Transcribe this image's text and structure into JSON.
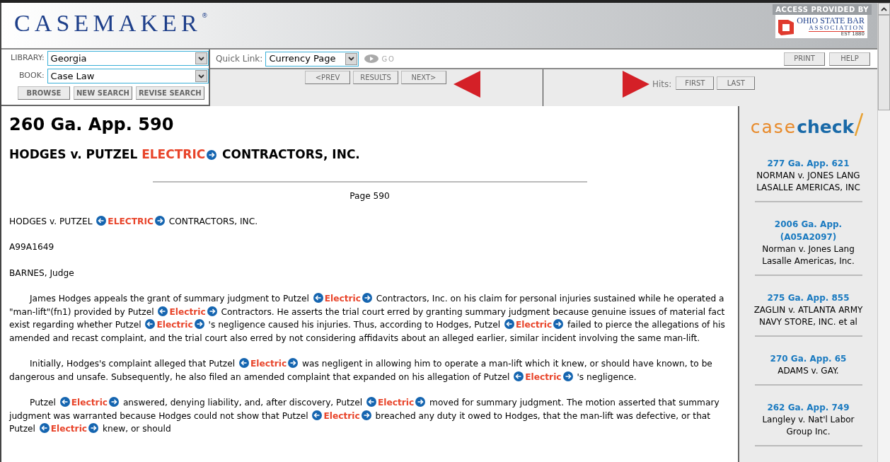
{
  "header": {
    "logo": "CASEMAKER",
    "logo_mark": "®",
    "access_label": "ACCESS PROVIDED BY",
    "partner": {
      "name": "OHIO STATE BAR",
      "subtitle": "ASSOCIATION",
      "est": "EST 1880"
    }
  },
  "search_panel": {
    "library": {
      "label": "LIBRARY:",
      "value": "Georgia"
    },
    "book": {
      "label": "BOOK:",
      "value": "Case Law"
    },
    "buttons": [
      "BROWSE",
      "NEW SEARCH",
      "REVISE SEARCH"
    ]
  },
  "quick_link": {
    "label": "Quick Link:",
    "value": "Currency Page",
    "go": "GO"
  },
  "top_buttons": [
    "PRINT",
    "HELP"
  ],
  "nav_buttons": [
    "<PREV",
    "RESULTS",
    "NEXT>"
  ],
  "hits": {
    "label": "Hits:",
    "buttons": [
      "FIRST",
      "LAST"
    ]
  },
  "document": {
    "citation": "260 Ga. App. 590",
    "title": [
      {
        "kind": "text",
        "text": "HODGES v. PUTZEL "
      },
      {
        "kind": "hit",
        "text": "ELECTRIC",
        "prev": false,
        "next": true
      },
      {
        "kind": "text",
        "text": " CONTRACTORS, INC."
      }
    ],
    "page_label": "Page 590",
    "blocks": [
      [
        {
          "kind": "text",
          "text": "HODGES v. PUTZEL "
        },
        {
          "kind": "hit",
          "text": "ELECTRIC",
          "prev": true,
          "next": true
        },
        {
          "kind": "text",
          "text": " CONTRACTORS, INC."
        }
      ],
      [
        {
          "kind": "text",
          "text": "A99A1649"
        }
      ],
      [
        {
          "kind": "text",
          "text": "BARNES, Judge"
        }
      ],
      [
        {
          "kind": "text",
          "text": "James Hodges appeals the grant of summary judgment to Putzel "
        },
        {
          "kind": "hit",
          "text": "Electric",
          "prev": true,
          "next": true
        },
        {
          "kind": "text",
          "text": " Contractors, Inc. on his claim for personal injuries sustained while he operated a \"man-lift\"(fn1) provided by Putzel "
        },
        {
          "kind": "hit",
          "text": "Electric",
          "prev": true,
          "next": true
        },
        {
          "kind": "text",
          "text": " Contractors. He asserts the trial court erred by granting summary judgment because genuine issues of material fact exist regarding whether Putzel "
        },
        {
          "kind": "hit",
          "text": "Electric",
          "prev": true,
          "next": true
        },
        {
          "kind": "text",
          "text": " 's negligence caused his injuries. Thus, according to Hodges, Putzel "
        },
        {
          "kind": "hit",
          "text": "Electric",
          "prev": true,
          "next": true
        },
        {
          "kind": "text",
          "text": " failed to pierce the allegations of his amended and recast complaint, and the trial court also erred by not considering affidavits about an alleged earlier, similar incident involving the same man-lift."
        }
      ],
      [
        {
          "kind": "text",
          "text": "Initially, Hodges's complaint alleged that Putzel "
        },
        {
          "kind": "hit",
          "text": "Electric",
          "prev": true,
          "next": true
        },
        {
          "kind": "text",
          "text": " was negligent in allowing him to operate a man-lift which it knew, or should have known, to be dangerous and unsafe. Subsequently, he also filed an amended complaint that expanded on his allegation of Putzel "
        },
        {
          "kind": "hit",
          "text": "Electric",
          "prev": true,
          "next": true
        },
        {
          "kind": "text",
          "text": " 's negligence."
        }
      ],
      [
        {
          "kind": "text",
          "text": "Putzel "
        },
        {
          "kind": "hit",
          "text": "Electric",
          "prev": true,
          "next": true
        },
        {
          "kind": "text",
          "text": " answered, denying liability, and, after discovery, Putzel "
        },
        {
          "kind": "hit",
          "text": "Electric",
          "prev": true,
          "next": true
        },
        {
          "kind": "text",
          "text": " moved for summary judgment. The motion asserted that summary judgment was warranted because Hodges could not show that Putzel "
        },
        {
          "kind": "hit",
          "text": "Electric",
          "prev": true,
          "next": true
        },
        {
          "kind": "text",
          "text": " breached any duty it owed to Hodges, that the man-lift was defective, or that Putzel "
        },
        {
          "kind": "hit",
          "text": "Electric",
          "prev": true,
          "next": true
        },
        {
          "kind": "text",
          "text": " knew, or should"
        }
      ]
    ]
  },
  "casecheck": {
    "logo_case": "case",
    "logo_check": "check",
    "cases": [
      {
        "citation": "277 Ga. App. 621",
        "name": "NORMAN v. JONES LANG LASALLE AMERICAS, INC"
      },
      {
        "citation": "2006 Ga. App. (A05A2097)",
        "name": "Norman v. Jones Lang Lasalle Americas, Inc."
      },
      {
        "citation": "275 Ga. App. 855",
        "name": "ZAGLIN v. ATLANTA ARMY NAVY STORE, INC. et al"
      },
      {
        "citation": "270 Ga. App. 65",
        "name": "ADAMS v. GAY."
      },
      {
        "citation": "262 Ga. App. 749",
        "name": "Langley v. Nat'l Labor Group Inc."
      }
    ]
  }
}
